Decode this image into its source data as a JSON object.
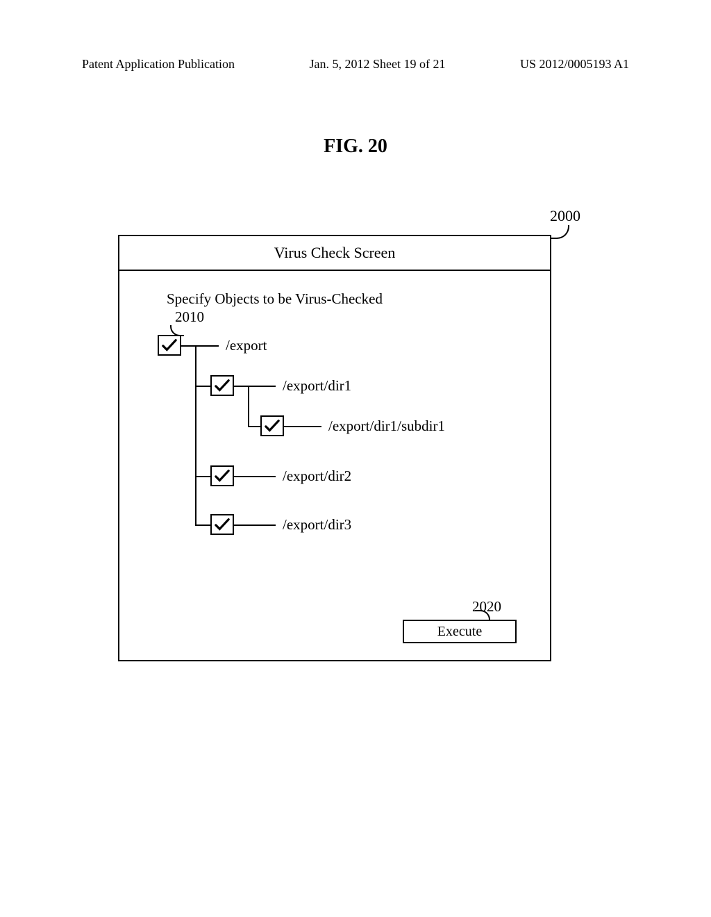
{
  "header": {
    "left": "Patent Application Publication",
    "center": "Jan. 5, 2012  Sheet 19 of 21",
    "right": "US 2012/0005193 A1"
  },
  "figure_title": "FIG. 20",
  "refs": {
    "r2000": "2000",
    "r2010": "2010",
    "r2020": "2020"
  },
  "screen": {
    "title": "Virus Check Screen",
    "specify_label": "Specify Objects to be Virus-Checked",
    "execute_label": "Execute"
  },
  "tree": {
    "n0": "/export",
    "n1": "/export/dir1",
    "n2": "/export/dir1/subdir1",
    "n3": "/export/dir2",
    "n4": "/export/dir3"
  }
}
